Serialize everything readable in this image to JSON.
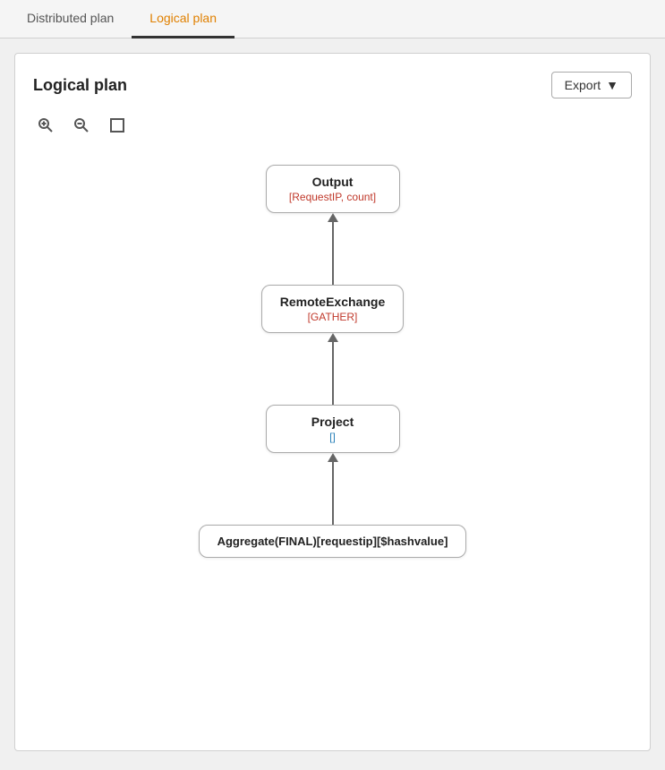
{
  "tabs": [
    {
      "id": "distributed",
      "label": "Distributed plan",
      "active": false
    },
    {
      "id": "logical",
      "label": "Logical plan",
      "active": true
    }
  ],
  "plan": {
    "title": "Logical plan",
    "export_label": "Export",
    "toolbar": {
      "zoom_in": "zoom-in",
      "zoom_out": "zoom-out",
      "fit": "fit"
    },
    "nodes": [
      {
        "id": "output",
        "title": "Output",
        "subtitle": "[RequestIP, count]",
        "subtitle_color": "red"
      },
      {
        "id": "remote_exchange",
        "title": "RemoteExchange",
        "subtitle": "[GATHER]",
        "subtitle_color": "red"
      },
      {
        "id": "project",
        "title": "Project",
        "subtitle": "[]",
        "subtitle_color": "blue"
      },
      {
        "id": "aggregate",
        "title": "Aggregate(FINAL)[requestip][$hashvalue]",
        "subtitle": "",
        "subtitle_color": ""
      }
    ]
  }
}
